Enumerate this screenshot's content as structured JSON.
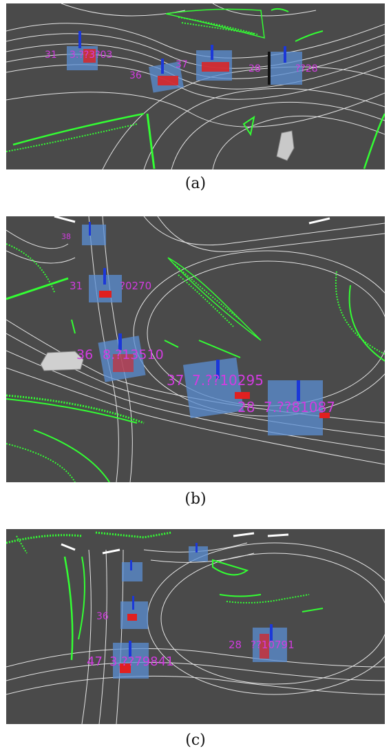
{
  "panels": [
    {
      "caption": "(a)",
      "labels": [
        "31",
        "3.??3?03",
        "36",
        "37",
        "28",
        "??28"
      ]
    },
    {
      "caption": "(b)",
      "labels": [
        "38",
        "31",
        "?0270",
        "36",
        "8.?13510",
        "37",
        "7.??10295",
        "28",
        "7.??81087"
      ]
    },
    {
      "caption": "(c)",
      "labels": [
        "36",
        "47",
        "3.??79841",
        "28",
        "??10791"
      ]
    }
  ],
  "colors": {
    "background": "#4a4a4a",
    "lane_lines": "#e8e8e8",
    "lidar_points": "#33ff33",
    "bbox_fill": "#5b8fd4",
    "arrow": "#e02020",
    "label": "#d23ce0"
  }
}
